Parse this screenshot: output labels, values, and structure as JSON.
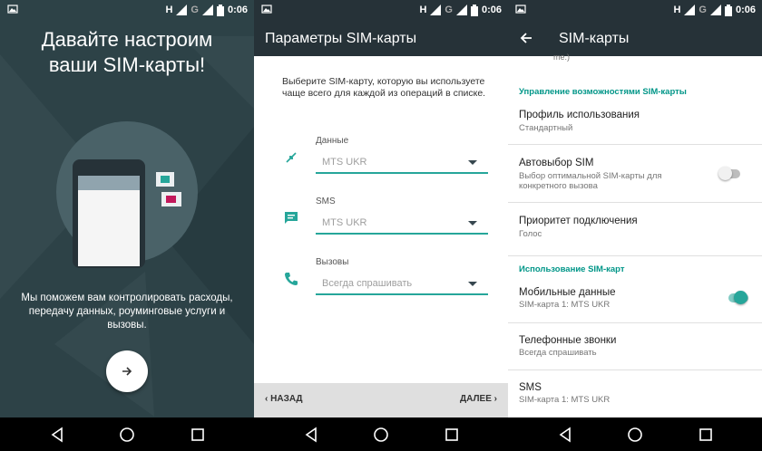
{
  "status_bar": {
    "network": "H",
    "network2": "G",
    "time": "0:06"
  },
  "screen1": {
    "title_line1": "Давайте настроим",
    "title_line2": "ваши SIM-карты!",
    "description": "Мы поможем вам контролировать расходы, передачу данных, роуминговые услуги и вызовы."
  },
  "screen2": {
    "title": "Параметры SIM-карты",
    "intro": "Выберите SIM-карту, которую вы используете чаще всего для каждой из операций в списке.",
    "operations": [
      {
        "icon": "data-swap-icon",
        "label": "Данные",
        "value": "MTS UKR"
      },
      {
        "icon": "sms-icon",
        "label": "SMS",
        "value": "MTS UKR"
      },
      {
        "icon": "phone-icon",
        "label": "Вызовы",
        "value": "Всегда спрашивать"
      }
    ],
    "back_label": "НАЗАД",
    "next_label": "ДАЛЕЕ"
  },
  "screen3": {
    "title": "SIM-карты",
    "partial_text": "me.)",
    "section1": "Управление возможностями SIM-карты",
    "usage_profile_title": "Профиль использования",
    "usage_profile_sub": "Стандартный",
    "auto_sim_title": "Автовыбор SIM",
    "auto_sim_sub": "Выбор оптимальной SIM-карты для конкретного вызова",
    "auto_sim_on": false,
    "priority_title": "Приоритет подключения",
    "priority_sub": "Голос",
    "section2": "Использование SIM-карт",
    "mobile_data_title": "Мобильные данные",
    "mobile_data_sub": "SIM-карта 1: MTS UKR",
    "mobile_data_on": true,
    "calls_title": "Телефонные звонки",
    "calls_sub": "Всегда спрашивать",
    "sms_title": "SMS",
    "sms_sub": "SIM-карта 1: MTS UKR"
  },
  "colors": {
    "accent": "#26a69a",
    "appbar": "#263238",
    "setup_bg": "#2d4247",
    "section_text": "#009688"
  }
}
